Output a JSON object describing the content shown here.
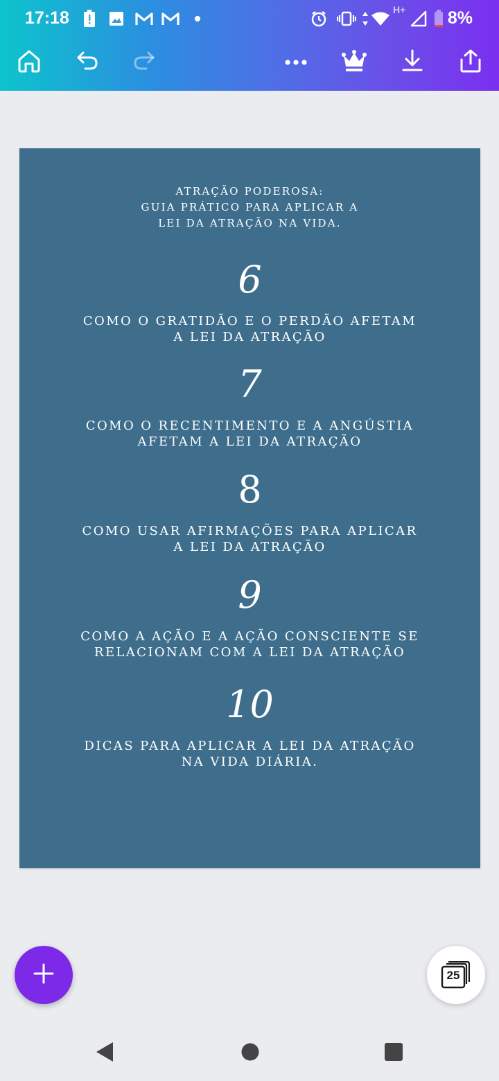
{
  "status_bar": {
    "time": "17:18",
    "battery_percent": "8%",
    "network_label": "H+"
  },
  "toolbar": {
    "icons": [
      "home-icon",
      "undo-icon",
      "redo-icon",
      "more-icon",
      "crown-icon",
      "download-icon",
      "share-icon"
    ]
  },
  "page": {
    "background": "#3e6e8c",
    "title": "ATRAÇÃO PODEROSA:\nGUIA PRÁTICO PARA APLICAR A\nLEI DA ATRAÇÃO NA VIDA.",
    "chapters": [
      {
        "number": "6",
        "text": "COMO O GRATIDÃO E O PERDÃO AFETAM\nA LEI DA ATRAÇÃO"
      },
      {
        "number": "7",
        "text": "COMO O RECENTIMENTO E A ANGÚSTIA\nAFETAM A LEI DA ATRAÇÃO"
      },
      {
        "number": "8",
        "text": "COMO USAR AFIRMAÇÕES PARA APLICAR\nA LEI DA ATRAÇÃO"
      },
      {
        "number": "9",
        "text": "COMO A AÇÃO E A AÇÃO CONSCIENTE SE\nRELACIONAM COM A LEI DA ATRAÇÃO"
      },
      {
        "number": "10",
        "text": "DICAS PARA APLICAR A LEI DA ATRAÇÃO\nNA VIDA DIÁRIA."
      }
    ]
  },
  "pages_button": {
    "count": "25"
  },
  "colors": {
    "accent": "#7d2ae8"
  }
}
